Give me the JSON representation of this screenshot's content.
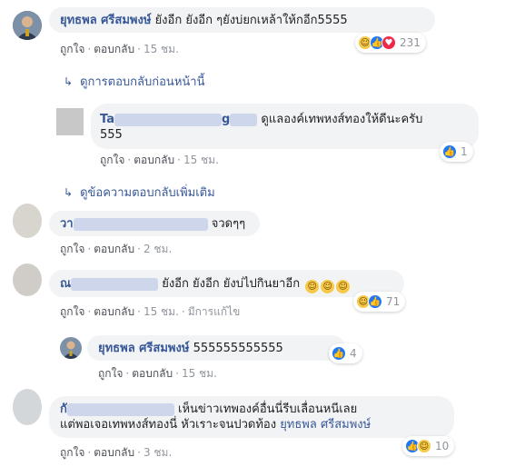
{
  "comments": {
    "main": {
      "author": "ยุทธพล ศรีสมพงษ์",
      "text": "ยังอีก ยังอีก ๆยังบ่ยกเหล้าให้กอีก5555",
      "like": "ถูกใจ",
      "reply": "ตอบกลับ",
      "time": "15 ชม.",
      "reaction_count": "231"
    },
    "view_previous": "ดูการตอบกลับก่อนหน้านี้",
    "reply1": {
      "author_visible": "Ta",
      "author_visible_2": "g",
      "text_line1": "ดูแลองค์เทพหงส์ทองให้ดีนะครับ",
      "text_line2": "555",
      "like": "ถูกใจ",
      "reply": "ตอบกลับ",
      "time": "15 ชม.",
      "reaction_count": "1"
    },
    "view_more": "ดูข้อความตอบกลับเพิ่มเติม",
    "c2": {
      "author_visible": "วา",
      "text": "จวดๆๆ",
      "like": "ถูกใจ",
      "reply": "ตอบกลับ",
      "time": "2 ชม."
    },
    "c3": {
      "author_visible": "ณ",
      "text": "ยังอีก ยังอีก ยังบ่ไปกินยาอีก",
      "like": "ถูกใจ",
      "reply": "ตอบกลับ",
      "time": "15 ชม.",
      "edited": "มีการแก้ไข",
      "reaction_count": "71"
    },
    "c3_reply": {
      "author": "ยุทธพล ศรีสมพงษ์",
      "text": "555555555555",
      "like": "ถูกใจ",
      "reply": "ตอบกลับ",
      "time": "15 ชม.",
      "reaction_count": "4"
    },
    "c4": {
      "author_visible": "กั",
      "text_line1": "เห็นข่าวเทพองค์อื่นนี่รีบเลื่อนหนีเลย",
      "text_line2": "แต่พอเจอเทพหงส์ทองนี่ หัวเราะจนปวดท้อง",
      "mention": "ยุทธพล ศรีสมพงษ์",
      "like": "ถูกใจ",
      "reply": "ตอบกลับ",
      "time": "3 ชม.",
      "reaction_count": "10"
    }
  },
  "icons": {
    "like": "like-reaction-icon",
    "haha": "haha-reaction-icon",
    "love": "love-reaction-icon",
    "reply_arrow": "reply-arrow-icon"
  },
  "colors": {
    "link": "#385898",
    "bubble": "#f2f3f5",
    "like_blue": "#2078f4",
    "love_red": "#f0284a",
    "haha_yellow": "#f7c948"
  }
}
